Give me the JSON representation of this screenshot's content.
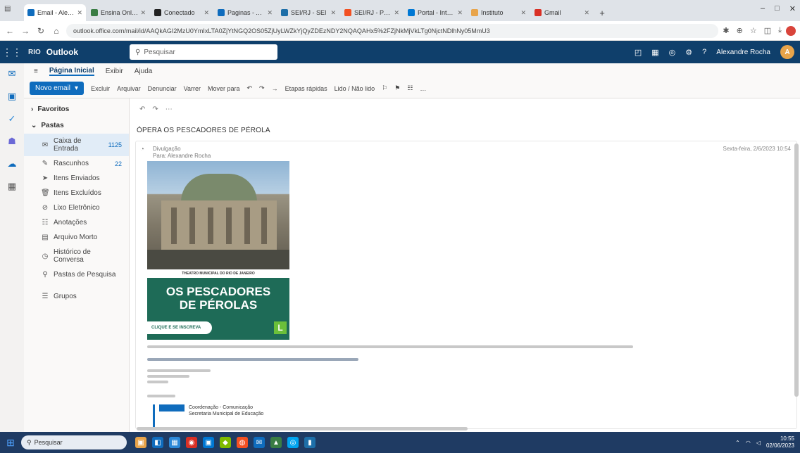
{
  "browser": {
    "tabs": [
      {
        "label": "Email - Alexandre",
        "color": "#0f6cbd",
        "active": true
      },
      {
        "label": "Ensina Online",
        "color": "#3a7d44"
      },
      {
        "label": "Conectado",
        "color": "#222222"
      },
      {
        "label": "Paginas - Ana",
        "color": "#0f6cbd"
      },
      {
        "label": "SEI/RJ - SEI",
        "color": "#1e6fa8"
      },
      {
        "label": "SEI/RJ - Portal",
        "color": "#f25022"
      },
      {
        "label": "Portal - Intranet",
        "color": "#0078d4"
      },
      {
        "label": "Instituto",
        "color": "#e8a44a"
      },
      {
        "label": "Gmail",
        "color": "#d93025"
      }
    ],
    "new_tab": "+",
    "url": "outlook.office.com/mail/id/AAQkAGI2MzU0YmIxLTA0ZjYtNGQ2OS05ZjUyLWZkYjQyZDEzNDY2NQAQAHx5%2FZjNkMjVkLTg0NjctNDlhNy05MmU3",
    "nav": {
      "back": "←",
      "forward": "→",
      "reload": "↻",
      "home": "⌂"
    },
    "ext_icons": [
      "✱",
      "⊕",
      "☆",
      "◫",
      "⤓"
    ],
    "window": {
      "min": "–",
      "max": "□",
      "close": "✕"
    }
  },
  "outlook": {
    "app_name": "Outlook",
    "logo_text": "RIO",
    "search_placeholder": "Pesquisar",
    "header_icons": [
      "◰",
      "▦",
      "◎",
      "⚙",
      "?"
    ],
    "user_name": "Alexandre Rocha",
    "avatar_initial": "A"
  },
  "apprail": [
    "✉",
    "▣",
    "✓",
    "☗",
    "☁",
    "▦"
  ],
  "ribbon": {
    "tabs": [
      "Página Inicial",
      "Exibir",
      "Ajuda"
    ],
    "new_mail": "Novo email",
    "buttons": [
      "Excluir",
      "Arquivar",
      "Denunciar",
      "Varrer",
      "Mover para",
      "↶",
      "↷",
      "→",
      "Etapas rápidas",
      "Lido / Não lido",
      "⚐",
      "⚑",
      "☷",
      "…"
    ]
  },
  "folders": {
    "favorites": "Favoritos",
    "pastas": "Pastas",
    "items": [
      {
        "icon": "✉",
        "name": "Caixa de Entrada",
        "count": "1125",
        "selected": true
      },
      {
        "icon": "✎",
        "name": "Rascunhos",
        "count": "22"
      },
      {
        "icon": "➤",
        "name": "Itens Enviados",
        "count": ""
      },
      {
        "icon": "🗑",
        "name": "Itens Excluídos",
        "count": ""
      },
      {
        "icon": "⊘",
        "name": "Lixo Eletrônico",
        "count": ""
      },
      {
        "icon": "☷",
        "name": "Anotações",
        "count": ""
      },
      {
        "icon": "▤",
        "name": "Arquivo Morto",
        "count": ""
      },
      {
        "icon": "◷",
        "name": "Histórico de Conversa",
        "count": ""
      },
      {
        "icon": "⚲",
        "name": "Pastas de Pesquisa",
        "count": ""
      }
    ],
    "groups": "Grupos"
  },
  "message": {
    "toolbar": [
      "↶",
      "↷",
      "⋯"
    ],
    "subject": "ÓPERA OS PESCADORES DE PÉROLA",
    "sender_lines": [
      "Divulgação",
      "Para: Alexandre Rocha"
    ],
    "date": "Sexta-feira, 2/6/2023 10:54",
    "flyer_caption": "THEATRO MUNICIPAL DO RIO DE JANEIRO",
    "flyer_title_1": "OS PESCADORES",
    "flyer_title_2": "DE PÉROLAS",
    "flyer_pill": "CLIQUE E SE INSCREVA",
    "flyer_badge": "L",
    "signature_title": "Coordenação - Comunicação",
    "signature_sub": "Secretaria Municipal de Educação"
  },
  "taskbar": {
    "search": "Pesquisar",
    "icons": [
      {
        "glyph": "▣",
        "color": "#e8a44a"
      },
      {
        "glyph": "◧",
        "color": "#0f6cbd"
      },
      {
        "glyph": "▦",
        "color": "#2b88d8"
      },
      {
        "glyph": "◉",
        "color": "#d93025"
      },
      {
        "glyph": "▣",
        "color": "#0078d4"
      },
      {
        "glyph": "◆",
        "color": "#7fba00"
      },
      {
        "glyph": "◍",
        "color": "#f25022"
      },
      {
        "glyph": "✉",
        "color": "#0f6cbd"
      },
      {
        "glyph": "▲",
        "color": "#3a7d44"
      },
      {
        "glyph": "◎",
        "color": "#00a4ef"
      },
      {
        "glyph": "▮",
        "color": "#1e6fa8"
      }
    ],
    "clock_time": "10:55",
    "clock_date": "02/06/2023"
  }
}
